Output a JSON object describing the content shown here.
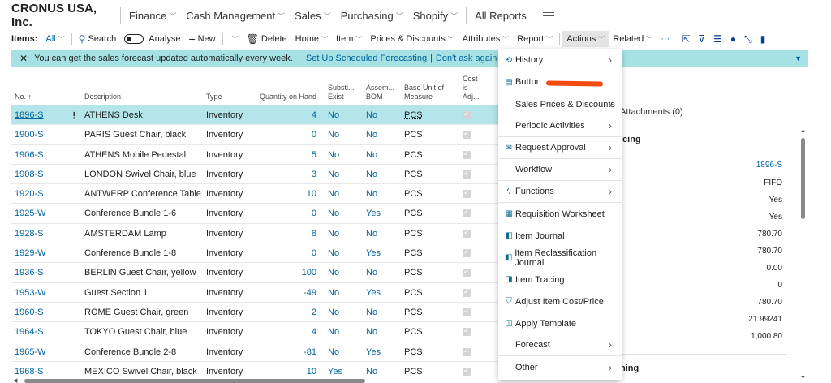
{
  "company": "CRONUS USA, Inc.",
  "nav": [
    {
      "label": "Finance",
      "chev": true
    },
    {
      "label": "Cash Management",
      "chev": true
    },
    {
      "label": "Sales",
      "chev": true
    },
    {
      "label": "Purchasing",
      "chev": true
    },
    {
      "label": "Shopify",
      "chev": true
    },
    {
      "label": "All Reports",
      "chev": false
    }
  ],
  "toolbar": {
    "items_label": "Items:",
    "filter": "All",
    "search": "Search",
    "analyse": "Analyse",
    "new": "New",
    "delete": "Delete",
    "home": "Home",
    "item": "Item",
    "prices": "Prices & Discounts",
    "attributes": "Attributes",
    "report": "Report",
    "actions": "Actions",
    "related": "Related",
    "more": "···"
  },
  "notification": {
    "text": "You can get the sales forecast updated automatically every week.",
    "link1": "Set Up Scheduled Forecasting",
    "sep": "|",
    "link2": "Don't ask again"
  },
  "table": {
    "headers": {
      "no": "No. ↑",
      "description": "Description",
      "type": "Type",
      "qty": "Quantity on Hand",
      "subst1": "Substi...",
      "subst2": "Exist",
      "asm1": "Assem...",
      "asm2": "BOM",
      "uom1": "Base Unit of",
      "uom2": "Measure",
      "cost1": "Cost",
      "cost2": "is",
      "cost3": "Adj..."
    },
    "rows": [
      {
        "no": "1896-S",
        "desc": "ATHENS Desk",
        "type": "Inventory",
        "qty": "4",
        "sub": "No",
        "asm": "No",
        "uom": "PCS"
      },
      {
        "no": "1900-S",
        "desc": "PARIS Guest Chair, black",
        "type": "Inventory",
        "qty": "0",
        "sub": "No",
        "asm": "No",
        "uom": "PCS"
      },
      {
        "no": "1906-S",
        "desc": "ATHENS Mobile Pedestal",
        "type": "Inventory",
        "qty": "5",
        "sub": "No",
        "asm": "No",
        "uom": "PCS"
      },
      {
        "no": "1908-S",
        "desc": "LONDON Swivel Chair, blue",
        "type": "Inventory",
        "qty": "3",
        "sub": "No",
        "asm": "No",
        "uom": "PCS"
      },
      {
        "no": "1920-S",
        "desc": "ANTWERP Conference Table",
        "type": "Inventory",
        "qty": "10",
        "sub": "No",
        "asm": "No",
        "uom": "PCS"
      },
      {
        "no": "1925-W",
        "desc": "Conference Bundle 1-6",
        "type": "Inventory",
        "qty": "0",
        "sub": "No",
        "asm": "Yes",
        "uom": "PCS"
      },
      {
        "no": "1928-S",
        "desc": "AMSTERDAM Lamp",
        "type": "Inventory",
        "qty": "8",
        "sub": "No",
        "asm": "No",
        "uom": "PCS"
      },
      {
        "no": "1929-W",
        "desc": "Conference Bundle 1-8",
        "type": "Inventory",
        "qty": "0",
        "sub": "No",
        "asm": "Yes",
        "uom": "PCS"
      },
      {
        "no": "1936-S",
        "desc": "BERLIN Guest Chair, yellow",
        "type": "Inventory",
        "qty": "100",
        "sub": "No",
        "asm": "No",
        "uom": "PCS"
      },
      {
        "no": "1953-W",
        "desc": "Guest Section 1",
        "type": "Inventory",
        "qty": "-49",
        "sub": "No",
        "asm": "Yes",
        "uom": "PCS"
      },
      {
        "no": "1960-S",
        "desc": "ROME Guest Chair, green",
        "type": "Inventory",
        "qty": "2",
        "sub": "No",
        "asm": "No",
        "uom": "PCS"
      },
      {
        "no": "1964-S",
        "desc": "TOKYO Guest Chair, blue",
        "type": "Inventory",
        "qty": "4",
        "sub": "No",
        "asm": "No",
        "uom": "PCS"
      },
      {
        "no": "1965-W",
        "desc": "Conference Bundle 2-8",
        "type": "Inventory",
        "qty": "-81",
        "sub": "No",
        "asm": "Yes",
        "uom": "PCS"
      },
      {
        "no": "1968-S",
        "desc": "MEXICO Swivel Chair, black",
        "type": "Inventory",
        "qty": "10",
        "sub": "Yes",
        "asm": "No",
        "uom": "PCS"
      }
    ]
  },
  "menu": [
    {
      "label": "History",
      "icon": "history-icon",
      "glyph": "⟲",
      "submenu": true
    },
    {
      "label": "Button",
      "icon": "button-icon",
      "glyph": "▤",
      "submenu": false
    },
    {
      "label": "Sales Prices & Discounts",
      "icon": "",
      "glyph": "",
      "submenu": true
    },
    {
      "label": "Periodic Activities",
      "icon": "",
      "glyph": "",
      "submenu": true
    },
    {
      "label": "Request Approval",
      "icon": "approval-icon",
      "glyph": "✉",
      "submenu": true
    },
    {
      "label": "Workflow",
      "icon": "",
      "glyph": "",
      "submenu": true
    },
    {
      "label": "Functions",
      "icon": "lightning-icon",
      "glyph": "ϟ",
      "submenu": true
    },
    {
      "label": "Requisition Worksheet",
      "icon": "worksheet-icon",
      "glyph": "▦",
      "submenu": false
    },
    {
      "label": "Item Journal",
      "icon": "journal-icon",
      "glyph": "◧",
      "submenu": false
    },
    {
      "label": "Item Reclassification Journal",
      "icon": "journal-icon",
      "glyph": "◧",
      "submenu": false
    },
    {
      "label": "Item Tracing",
      "icon": "tracing-icon",
      "glyph": "◨",
      "submenu": false
    },
    {
      "label": "Adjust Item Cost/Price",
      "icon": "adjust-cost-icon",
      "glyph": "⛉",
      "submenu": false
    },
    {
      "label": "Apply Template",
      "icon": "template-icon",
      "glyph": "◫",
      "submenu": false
    },
    {
      "label": "Forecast",
      "icon": "",
      "glyph": "",
      "submenu": true
    },
    {
      "label": "Other",
      "icon": "",
      "glyph": "",
      "submenu": true
    }
  ],
  "factbox": {
    "attachments": "Attachments (0)",
    "invoicing": "icing",
    "values": [
      "1896-S",
      "FIFO",
      "Yes",
      "Yes",
      "780.70",
      "780.70",
      "0.00",
      "0",
      "780.70",
      "21.99241",
      "1,000.80"
    ],
    "planning": "ning"
  },
  "colors": {
    "accent": "#00639e",
    "selected_row": "#b3e5ea",
    "notification": "#a6e1e4",
    "redline": "#f34a12"
  }
}
